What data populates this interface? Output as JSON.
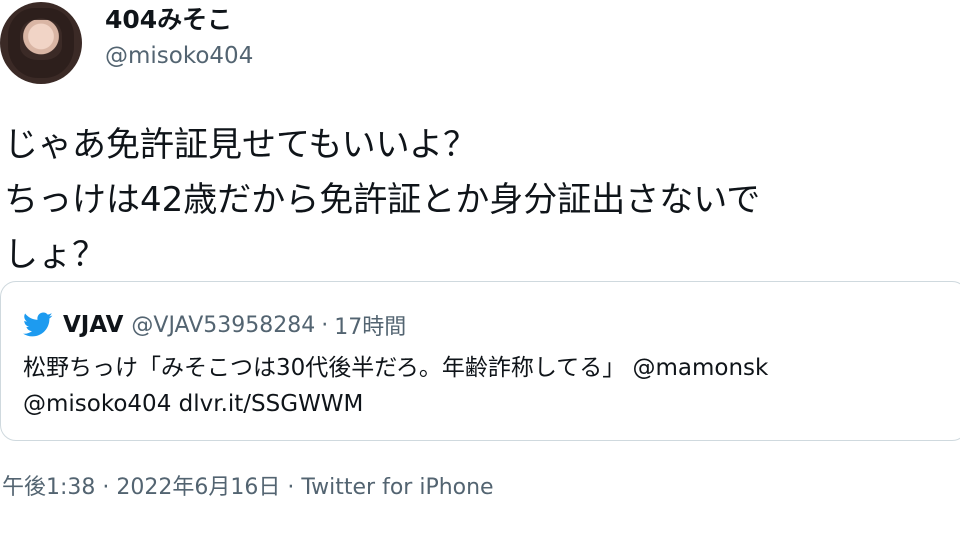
{
  "author": {
    "name": "404みそこ",
    "handle": "@misoko404"
  },
  "tweet": {
    "lines": [
      "じゃあ免許証見せてもいいよ？",
      "ちっけは42歳だから免許証とか身分証出さないで",
      "しょ？"
    ]
  },
  "quote": {
    "icon": "twitter-bird-icon",
    "name": "VJAV",
    "handle": "@VJAV53958284",
    "separator": "·",
    "time": "17時間",
    "lines": [
      "松野ちっけ「みそこつは30代後半だろ。年齢詐称してる」 @mamonsk",
      "@misoko404 dlvr.it/SSGWWM"
    ]
  },
  "meta": {
    "time": "午後1:38",
    "separator1": " · ",
    "date": "2022年6月16日",
    "separator2": " · ",
    "source": "Twitter for iPhone"
  },
  "colors": {
    "text": "#0f1419",
    "secondary": "#536471",
    "border": "#cfd9de",
    "twitter_blue": "#1d9bf0"
  }
}
